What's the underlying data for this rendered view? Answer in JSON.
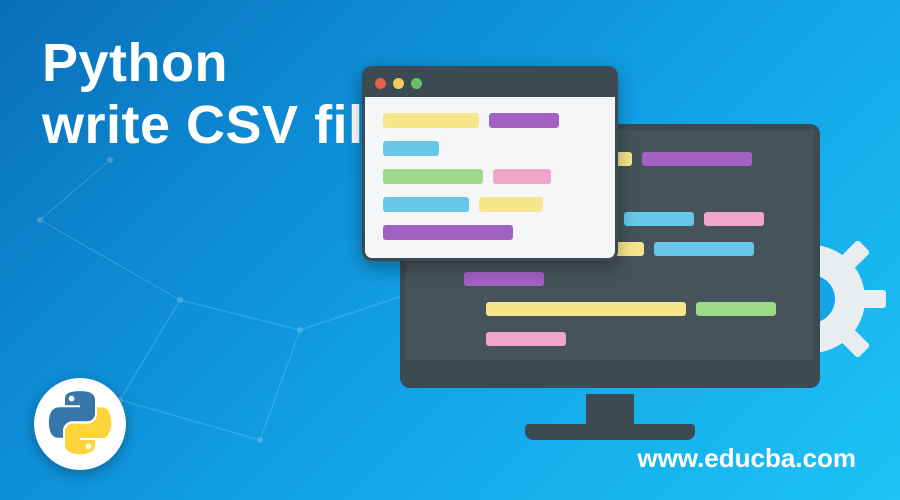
{
  "title_line1": "Python",
  "title_line2": "write CSV file",
  "site_url": "www.educba.com",
  "logo_name": "python-logo",
  "colors": {
    "bg_grad_start": "#0a6eb8",
    "bg_grad_end": "#1dc4f5",
    "monitor_frame": "#3c4a52",
    "monitor_face": "#46535b",
    "yellow": "#f6e68a",
    "purple": "#a361c4",
    "blue": "#66c7e8",
    "green": "#9ed98a",
    "pink": "#f0a6c9",
    "dot_red": "#e4604a",
    "dot_yellow": "#f6c95e",
    "dot_green": "#6cc06a"
  }
}
